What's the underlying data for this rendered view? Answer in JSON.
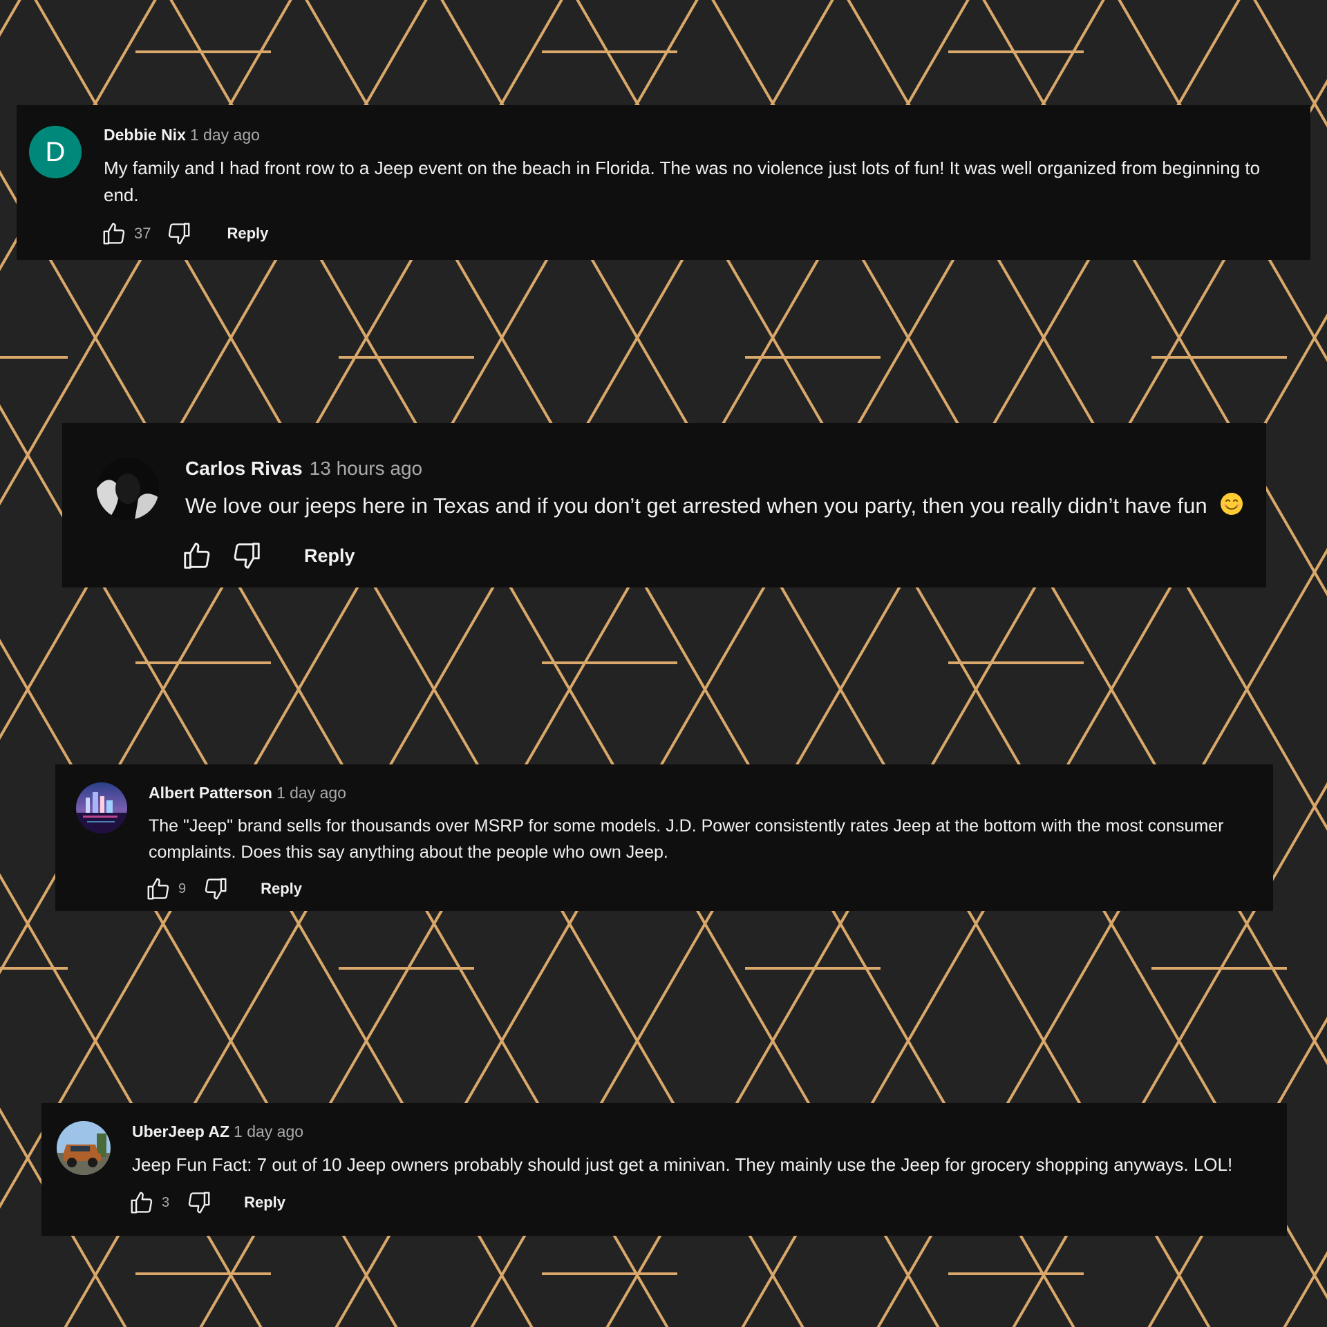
{
  "colors": {
    "panel": "#0f0f0f",
    "background": "#232323",
    "gold": "#d9a86a",
    "avatar_d": "#00897b"
  },
  "comments": [
    {
      "author": "Debbie Nix",
      "time": "1 day ago",
      "avatar_letter": "D",
      "text": "My family and I had front row to a Jeep event on the beach in Florida. The was no violence just lots of fun! It was well organized from beginning to end.",
      "likes": "37",
      "reply_label": "Reply"
    },
    {
      "author": "Carlos Rivas",
      "time": "13 hours ago",
      "text": "We love our jeeps here in Texas and if you don’t get arrested when you party, then you really didn’t have fun",
      "emoji": "smiling-face-icon",
      "reply_label": "Reply"
    },
    {
      "author": "Albert Patterson",
      "time": "1 day ago",
      "text": "The \"Jeep\" brand sells for thousands over MSRP for some models. J.D. Power consistently rates Jeep at the bottom with the most consumer complaints. Does this say anything about the people who own Jeep.",
      "likes": "9",
      "reply_label": "Reply"
    },
    {
      "author": "UberJeep AZ",
      "time": "1 day ago",
      "text": "Jeep Fun Fact: 7 out of 10 Jeep owners probably should just get a minivan. They mainly use the Jeep for grocery shopping anyways. LOL!",
      "likes": "3",
      "reply_label": "Reply"
    }
  ]
}
